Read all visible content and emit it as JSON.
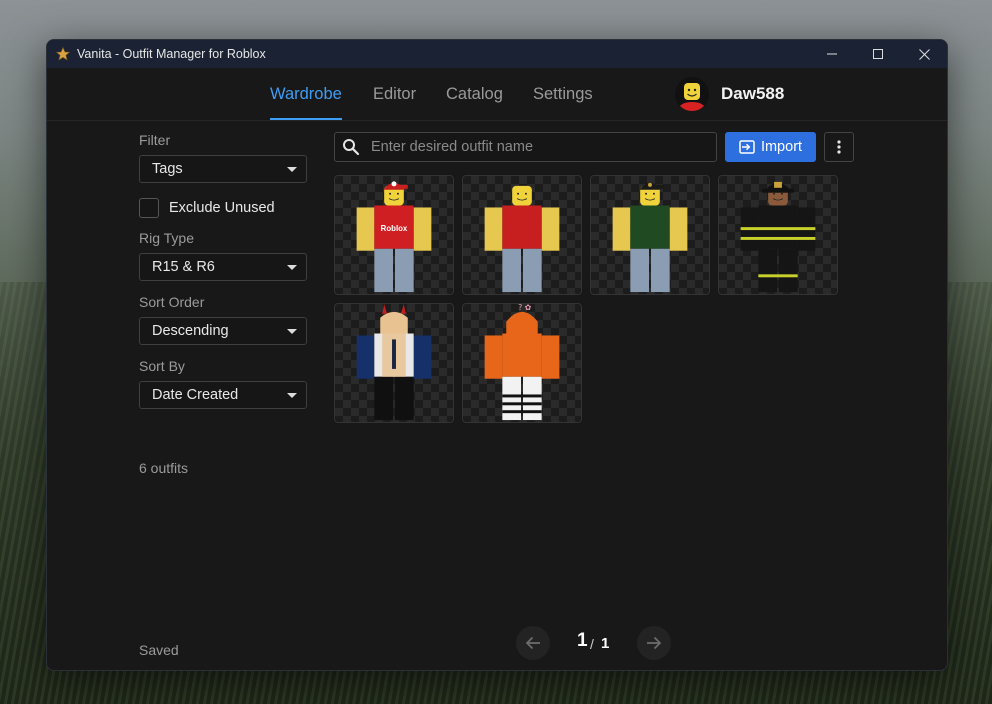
{
  "window": {
    "title": "Vanita - Outfit Manager for Roblox"
  },
  "nav": {
    "tabs": [
      {
        "label": "Wardrobe",
        "active": true
      },
      {
        "label": "Editor",
        "active": false
      },
      {
        "label": "Catalog",
        "active": false
      },
      {
        "label": "Settings",
        "active": false
      }
    ],
    "username": "Daw588"
  },
  "sidebar": {
    "filter_label": "Filter",
    "filter_value": "Tags",
    "exclude_unused_label": "Exclude Unused",
    "exclude_unused_checked": false,
    "rig_type_label": "Rig Type",
    "rig_type_value": "R15 & R6",
    "sort_order_label": "Sort Order",
    "sort_order_value": "Descending",
    "sort_by_label": "Sort By",
    "sort_by_value": "Date Created",
    "count_text": "6 outfits",
    "status_text": "Saved"
  },
  "toolbar": {
    "search_placeholder": "Enter desired outfit name",
    "import_label": "Import"
  },
  "outfits": [
    {
      "torso": "#d01f22",
      "arms": "#e6c74f",
      "legs": "#8a9db2",
      "hat": "red-cap",
      "shirt_text": "Roblox"
    },
    {
      "torso": "#c71f1f",
      "arms": "#e6c74f",
      "legs": "#8a9db2",
      "hat": "none",
      "shirt_text": ""
    },
    {
      "torso": "#1f4a22",
      "arms": "#e6c74f",
      "legs": "#8a9db2",
      "hat": "black-cap",
      "shirt_text": ""
    },
    {
      "torso": "#151515",
      "arms": "#151515",
      "legs": "#151515",
      "hat": "fire-helmet",
      "shirt_text": ""
    },
    {
      "torso": "#e8e8e8",
      "arms": "#16306a",
      "legs": "#101010",
      "hat": "horns",
      "shirt_text": ""
    },
    {
      "torso": "#e8661a",
      "arms": "#e8661a",
      "legs": "#f2f2f2",
      "hat": "orange-hood",
      "shirt_text": ""
    }
  ],
  "pagination": {
    "current": "1",
    "separator": "/",
    "total": "1"
  },
  "colors": {
    "accent": "#3e9df5",
    "import_button": "#2e6fe0",
    "titlebar": "#1b2233",
    "window_bg": "#181818"
  }
}
